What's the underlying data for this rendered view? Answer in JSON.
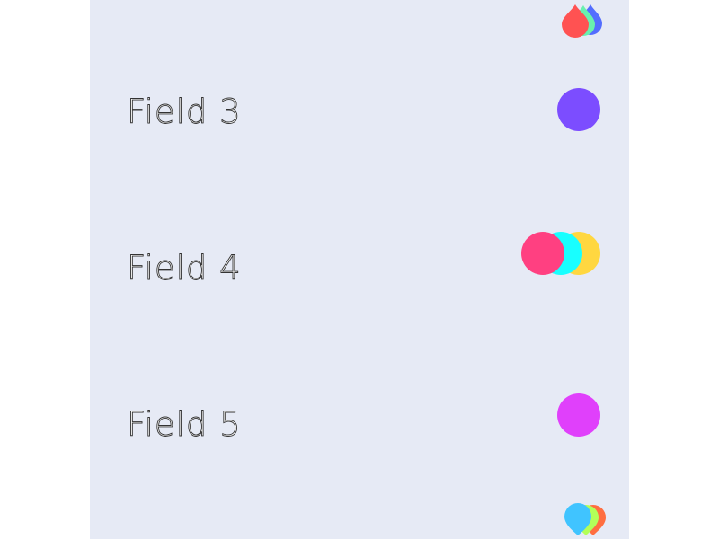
{
  "fields": [
    {
      "label": "Field 3",
      "icon": "single-circle-icon",
      "colors": [
        "#7c4dff"
      ]
    },
    {
      "label": "Field 4",
      "icon": "overlapping-circles-icon",
      "colors": [
        "#ff4081",
        "#18ffff",
        "#ffd740"
      ]
    },
    {
      "label": "Field 5",
      "icon": "single-circle-icon",
      "colors": [
        "#e040fb"
      ]
    }
  ],
  "top_icon": {
    "name": "water-drops-icon",
    "colors": [
      "#ff5252",
      "#69f0ae",
      "#536dfe"
    ]
  },
  "bottom_icon": {
    "name": "map-pins-icon",
    "colors": [
      "#40c4ff",
      "#b2ff59",
      "#ff6e40"
    ]
  }
}
